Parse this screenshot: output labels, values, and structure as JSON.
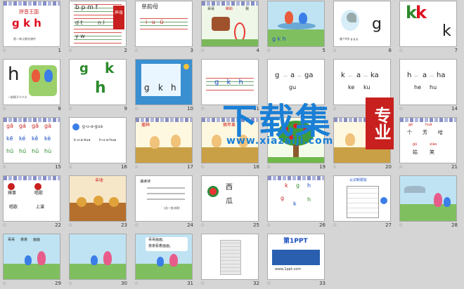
{
  "slides": [
    {
      "n": "1",
      "t": [
        "拼音王国",
        "g k h",
        "第一单元教学课件"
      ]
    },
    {
      "n": "2",
      "t": [
        "b p m f",
        "d t",
        "n l",
        "y w",
        "声母"
      ]
    },
    {
      "n": "3",
      "t": [
        "单韵母",
        "i u ü"
      ]
    },
    {
      "n": "4",
      "t": [
        "哥哥",
        "蝌蚪",
        "我"
      ]
    },
    {
      "n": "5",
      "t": [
        "g k h"
      ]
    },
    {
      "n": "6",
      "t": [
        "g",
        "像个9字 g g g"
      ]
    },
    {
      "n": "7",
      "t": [
        "k",
        "k",
        "k"
      ]
    },
    {
      "n": "8",
      "t": [
        "h",
        "h",
        "一把椅子 h h h"
      ]
    },
    {
      "n": "9",
      "t": [
        "g",
        "k",
        "h"
      ]
    },
    {
      "n": "10",
      "t": [
        "g",
        "k",
        "h"
      ]
    },
    {
      "n": "11",
      "t": [
        "g k h"
      ]
    },
    {
      "n": "12",
      "t": [
        "g",
        "a",
        "ga",
        "gu"
      ]
    },
    {
      "n": "13",
      "t": [
        "k",
        "a",
        "ka",
        "ke",
        "ku"
      ]
    },
    {
      "n": "14",
      "t": [
        "h",
        "a",
        "ha",
        "he",
        "hu"
      ]
    },
    {
      "n": "15",
      "t": [
        "gā",
        "gá",
        "gǎ",
        "gà",
        "kē",
        "ké",
        "kě",
        "kè",
        "hū",
        "hú",
        "hǔ",
        "hù"
      ]
    },
    {
      "n": "16",
      "t": [
        "g-u-a-gua",
        "k-u-a-kua",
        "h-u-a-hua"
      ]
    },
    {
      "n": "17",
      "t": [
        "播种"
      ]
    },
    {
      "n": "18",
      "t": [
        "摘苹果"
      ]
    },
    {
      "n": "19",
      "t": []
    },
    {
      "n": "20",
      "t": []
    },
    {
      "n": "21",
      "t": [
        "gè",
        "huā",
        "个",
        "芳",
        "哈",
        "gū",
        "xiào",
        "姑",
        "笑"
      ]
    },
    {
      "n": "22",
      "t": [
        "辣事",
        "唱歌",
        "上课",
        "唱歌"
      ]
    },
    {
      "n": "23",
      "t": [
        "丰收"
      ]
    },
    {
      "n": "24",
      "t": [
        "诵读诗",
        "(选一首诗歌)"
      ]
    },
    {
      "n": "25",
      "t": [
        "西",
        "瓜"
      ]
    },
    {
      "n": "26",
      "t": [
        "k",
        "g",
        "h",
        "g",
        "k",
        "h"
      ]
    },
    {
      "n": "27",
      "t": [
        "认识新朋友"
      ]
    },
    {
      "n": "28",
      "t": []
    },
    {
      "n": "29",
      "t": [
        "哥哥",
        "弟弟",
        "画画"
      ]
    },
    {
      "n": "30",
      "t": []
    },
    {
      "n": "31",
      "t": [
        "哥哥画画,",
        "弟弟看着画画。"
      ]
    },
    {
      "n": "32",
      "t": []
    },
    {
      "n": "33",
      "t": [
        "第1PPT",
        "www.1ppt.com"
      ]
    }
  ],
  "watermark": {
    "main": "下载集",
    "badge": "专业",
    "url": "www.xiazaiji.com"
  },
  "star_icon": "☆",
  "colors": {
    "accent": "#1a7fd6",
    "badge": "#c8201e",
    "red": "#d9534f"
  }
}
